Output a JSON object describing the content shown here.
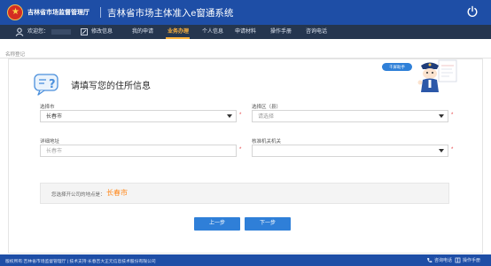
{
  "header": {
    "agency": "吉林省市场监督管理厅",
    "system_title": "吉林省市场主体准入e窗通系统"
  },
  "navbar": {
    "welcome": "欢迎您：",
    "change_info": "修改信息",
    "items": [
      {
        "label": "我的申请",
        "active": false
      },
      {
        "label": "业务办理",
        "active": true
      },
      {
        "label": "个人信息",
        "active": false
      },
      {
        "label": "申请材料",
        "active": false
      },
      {
        "label": "操作手册",
        "active": false
      },
      {
        "label": "咨询电话",
        "active": false
      }
    ]
  },
  "breadcrumb": "名称登记",
  "helper": {
    "label": "千屏助手"
  },
  "form": {
    "heading": "请填写您的住所信息",
    "city": {
      "label": "选择市",
      "value": "长春市"
    },
    "district": {
      "label": "选择区（县）",
      "placeholder": "请选择"
    },
    "address": {
      "label": "详细地址",
      "placeholder": "长春市"
    },
    "authority": {
      "label": "核准机关机关",
      "value": ""
    },
    "required_mark": "*"
  },
  "info": {
    "label": "您选择开公司的地点是：",
    "value": "长春市"
  },
  "buttons": {
    "prev": "上一步",
    "next": "下一步"
  },
  "footer": {
    "copyright": "版权所有:吉林省市场监督管理厅 | 技术支持:长春吉大正元信息技术股份有限公司",
    "hotline": "咨询电话",
    "manual": "操作手册"
  },
  "colors": {
    "header_blue": "#1e4ea6",
    "nav_dark": "#25364f",
    "active_orange": "#ffb23c",
    "button_blue": "#2f7fd8",
    "required_red": "#e4393c",
    "highlight_orange": "#ff8a1f"
  }
}
